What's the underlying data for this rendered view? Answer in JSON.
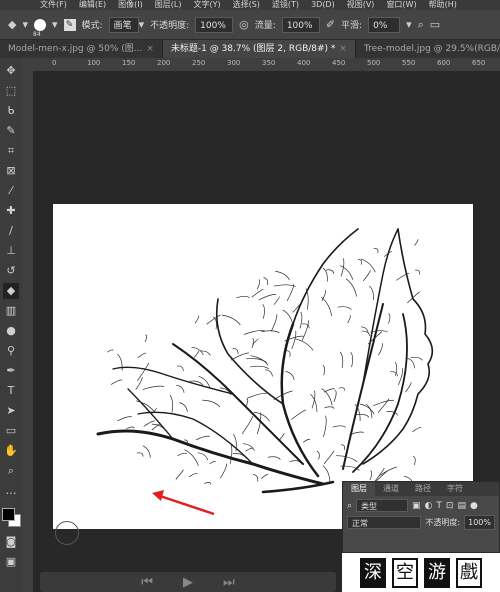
{
  "menu": [
    "文件(F)",
    "编辑(E)",
    "图像(I)",
    "图层(L)",
    "文字(Y)",
    "选择(S)",
    "滤镜(T)",
    "3D(D)",
    "视图(V)",
    "窗口(W)",
    "帮助(H)"
  ],
  "options": {
    "brush_size": "84",
    "mode_label": "模式:",
    "mode_value": "画笔",
    "opacity_label": "不透明度:",
    "opacity_value": "100%",
    "flow_label": "流量:",
    "flow_value": "100%",
    "smooth_label": "平滑:",
    "smooth_value": "0%"
  },
  "tabs": [
    {
      "label": "Model-men-x.jpg @ 50% (图..."
    },
    {
      "label": "未标题-1 @ 38.7% (图层 2, RGB/8#) *"
    },
    {
      "label": "Tree-model.jpg @ 29.5%(RGB/..."
    }
  ],
  "ruler_top": [
    "0",
    "100",
    "150",
    "200",
    "250",
    "300",
    "350",
    "400",
    "450",
    "500",
    "550",
    "600",
    "650"
  ],
  "layers_panel": {
    "tabs": [
      "图层",
      "通道",
      "路径",
      "字符"
    ],
    "filter_label": "类型",
    "blend_mode": "正常",
    "opacity_label": "不透明度:",
    "opacity_value": "100%"
  },
  "watermark": [
    "深",
    "空",
    "游",
    "戲"
  ],
  "colors": {
    "foreground": "#000000",
    "background": "#ffffff",
    "arrow": "#e02020"
  },
  "icons": {
    "tools": [
      "move-icon",
      "marquee-icon",
      "lasso-icon",
      "quick-select-icon",
      "crop-icon",
      "frame-icon",
      "eyedropper-icon",
      "healing-icon",
      "brush-icon",
      "stamp-icon",
      "history-brush-icon",
      "eraser-icon",
      "gradient-icon",
      "blur-icon",
      "dodge-icon",
      "pen-icon",
      "type-icon",
      "path-select-icon",
      "shape-icon",
      "hand-icon",
      "zoom-icon",
      "more-icon"
    ]
  }
}
